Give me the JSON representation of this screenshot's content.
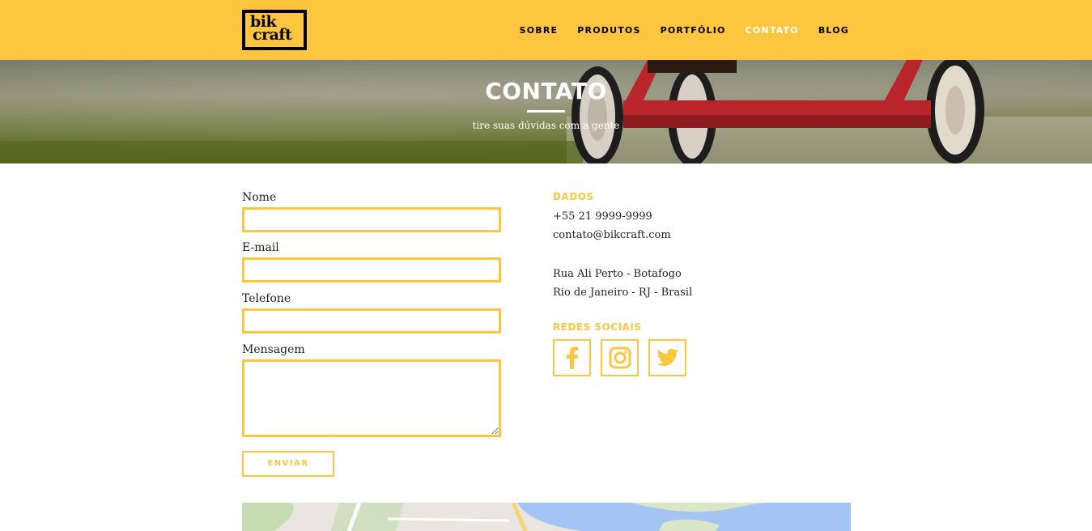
{
  "header": {
    "logo_line1": "bik",
    "logo_line2": "craft",
    "nav": [
      "SOBRE",
      "PRODUTOS",
      "PORTFÓLIO",
      "CONTATO",
      "BLOG"
    ],
    "active_nav": "CONTATO"
  },
  "hero": {
    "title": "CONTATO",
    "subtitle": "tire suas dúvidas com a gente"
  },
  "form": {
    "name_label": "Nome",
    "email_label": "E-mail",
    "phone_label": "Telefone",
    "message_label": "Mensagem",
    "submit_label": "ENVIAR"
  },
  "info": {
    "data_heading": "DADOS",
    "phone": "+55 21 9999-9999",
    "email": "contato@bikcraft.com",
    "address_line1": "Rua Ali Perto - Botafogo",
    "address_line2": "Rio de Janeiro - RJ - Brasil",
    "social_heading": "REDES SOCIAIS",
    "social_icons": [
      "facebook-icon",
      "instagram-icon",
      "twitter-icon"
    ]
  },
  "colors": {
    "accent": "#fec63f",
    "text": "#222222",
    "white": "#ffffff"
  }
}
